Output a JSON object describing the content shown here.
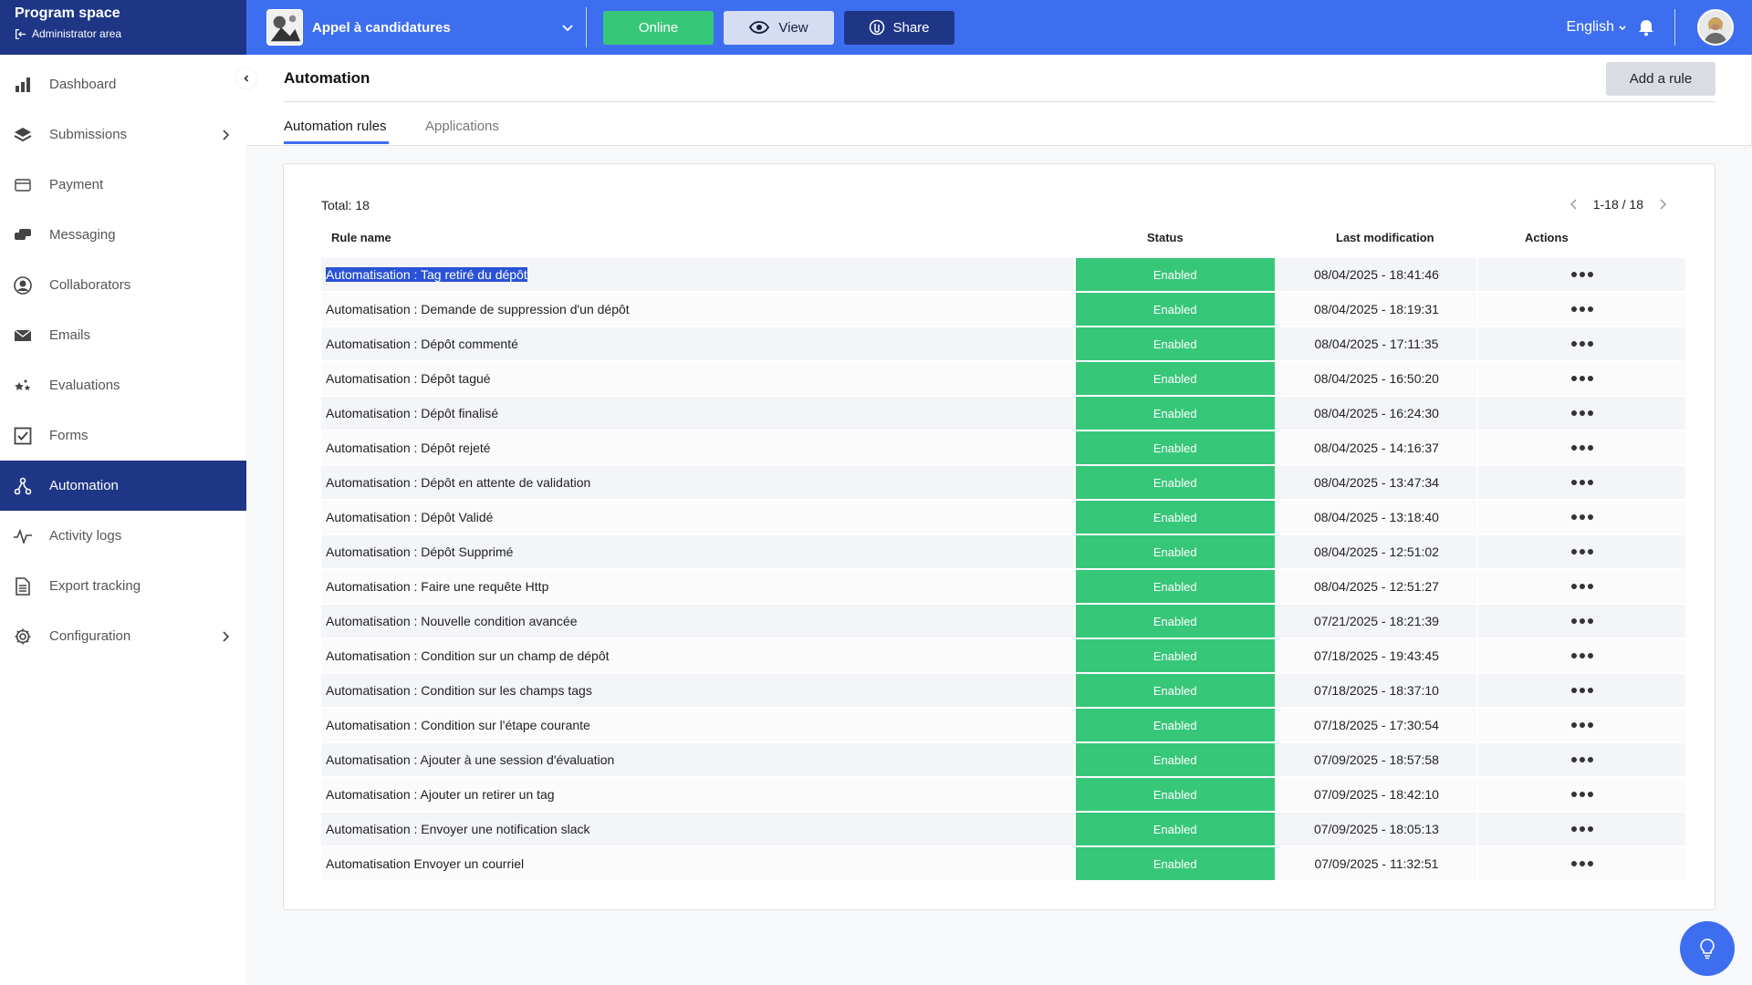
{
  "brand": {
    "title": "Program space",
    "subtitle": "Administrator area"
  },
  "program": {
    "name": "Appel à candidatures"
  },
  "topbar": {
    "online_label": "Online",
    "view_label": "View",
    "share_label": "Share",
    "language": "English"
  },
  "sidebar": {
    "items": [
      {
        "label": "Dashboard",
        "icon": "bar-chart-icon"
      },
      {
        "label": "Submissions",
        "icon": "layers-icon",
        "has_arrow": true
      },
      {
        "label": "Payment",
        "icon": "credit-card-icon"
      },
      {
        "label": "Messaging",
        "icon": "chat-icon"
      },
      {
        "label": "Collaborators",
        "icon": "person-circle-icon"
      },
      {
        "label": "Emails",
        "icon": "envelope-icon"
      },
      {
        "label": "Evaluations",
        "icon": "stars-icon"
      },
      {
        "label": "Forms",
        "icon": "checkbox-icon"
      },
      {
        "label": "Automation",
        "icon": "automation-icon",
        "active": true
      },
      {
        "label": "Activity logs",
        "icon": "activity-icon"
      },
      {
        "label": "Export tracking",
        "icon": "document-icon"
      },
      {
        "label": "Configuration",
        "icon": "gear-icon",
        "has_arrow": true
      }
    ]
  },
  "page": {
    "title": "Automation",
    "add_rule_label": "Add a rule",
    "tabs": [
      {
        "label": "Automation rules",
        "active": true
      },
      {
        "label": "Applications",
        "active": false
      }
    ]
  },
  "table": {
    "total_label": "Total: 18",
    "pager_label": "1-18 / 18",
    "columns": {
      "name": "Rule name",
      "status": "Status",
      "modified": "Last modification",
      "actions": "Actions"
    },
    "status_color": "#37c779",
    "rows": [
      {
        "name": "Automatisation : Tag retiré du dépôt",
        "status": "Enabled",
        "modified": "08/04/2025 - 18:41:46",
        "selected": true
      },
      {
        "name": "Automatisation : Demande de suppression d'un dépôt",
        "status": "Enabled",
        "modified": "08/04/2025 - 18:19:31"
      },
      {
        "name": "Automatisation : Dépôt commenté",
        "status": "Enabled",
        "modified": "08/04/2025 - 17:11:35"
      },
      {
        "name": "Automatisation : Dépôt tagué",
        "status": "Enabled",
        "modified": "08/04/2025 - 16:50:20"
      },
      {
        "name": "Automatisation : Dépôt finalisé",
        "status": "Enabled",
        "modified": "08/04/2025 - 16:24:30"
      },
      {
        "name": "Automatisation : Dépôt rejeté",
        "status": "Enabled",
        "modified": "08/04/2025 - 14:16:37"
      },
      {
        "name": "Automatisation : Dépôt en attente de validation",
        "status": "Enabled",
        "modified": "08/04/2025 - 13:47:34"
      },
      {
        "name": "Automatisation : Dépôt Validé",
        "status": "Enabled",
        "modified": "08/04/2025 - 13:18:40"
      },
      {
        "name": "Automatisation : Dépôt Supprimé",
        "status": "Enabled",
        "modified": "08/04/2025 - 12:51:02"
      },
      {
        "name": "Automatisation : Faire une requête Http",
        "status": "Enabled",
        "modified": "08/04/2025 - 12:51:27"
      },
      {
        "name": "Automatisation : Nouvelle condition avancée",
        "status": "Enabled",
        "modified": "07/21/2025 - 18:21:39"
      },
      {
        "name": "Automatisation : Condition sur un champ de dépôt",
        "status": "Enabled",
        "modified": "07/18/2025 - 19:43:45"
      },
      {
        "name": "Automatisation : Condition sur les champs tags",
        "status": "Enabled",
        "modified": "07/18/2025 - 18:37:10"
      },
      {
        "name": "Automatisation : Condition sur l'étape courante",
        "status": "Enabled",
        "modified": "07/18/2025 - 17:30:54"
      },
      {
        "name": "Automatisation : Ajouter à une session d'évaluation",
        "status": "Enabled",
        "modified": "07/09/2025 - 18:57:58"
      },
      {
        "name": "Automatisation : Ajouter un retirer un tag",
        "status": "Enabled",
        "modified": "07/09/2025 - 18:42:10"
      },
      {
        "name": "Automatisation : Envoyer une notification slack",
        "status": "Enabled",
        "modified": "07/09/2025 - 18:05:13"
      },
      {
        "name": "Automatisation Envoyer un courriel",
        "status": "Enabled",
        "modified": "07/09/2025 - 11:32:51"
      }
    ]
  },
  "colors": {
    "topbar": "#3d6ef0",
    "brand": "#1f3686",
    "online": "#37c779",
    "active_nav": "#1f3686"
  }
}
